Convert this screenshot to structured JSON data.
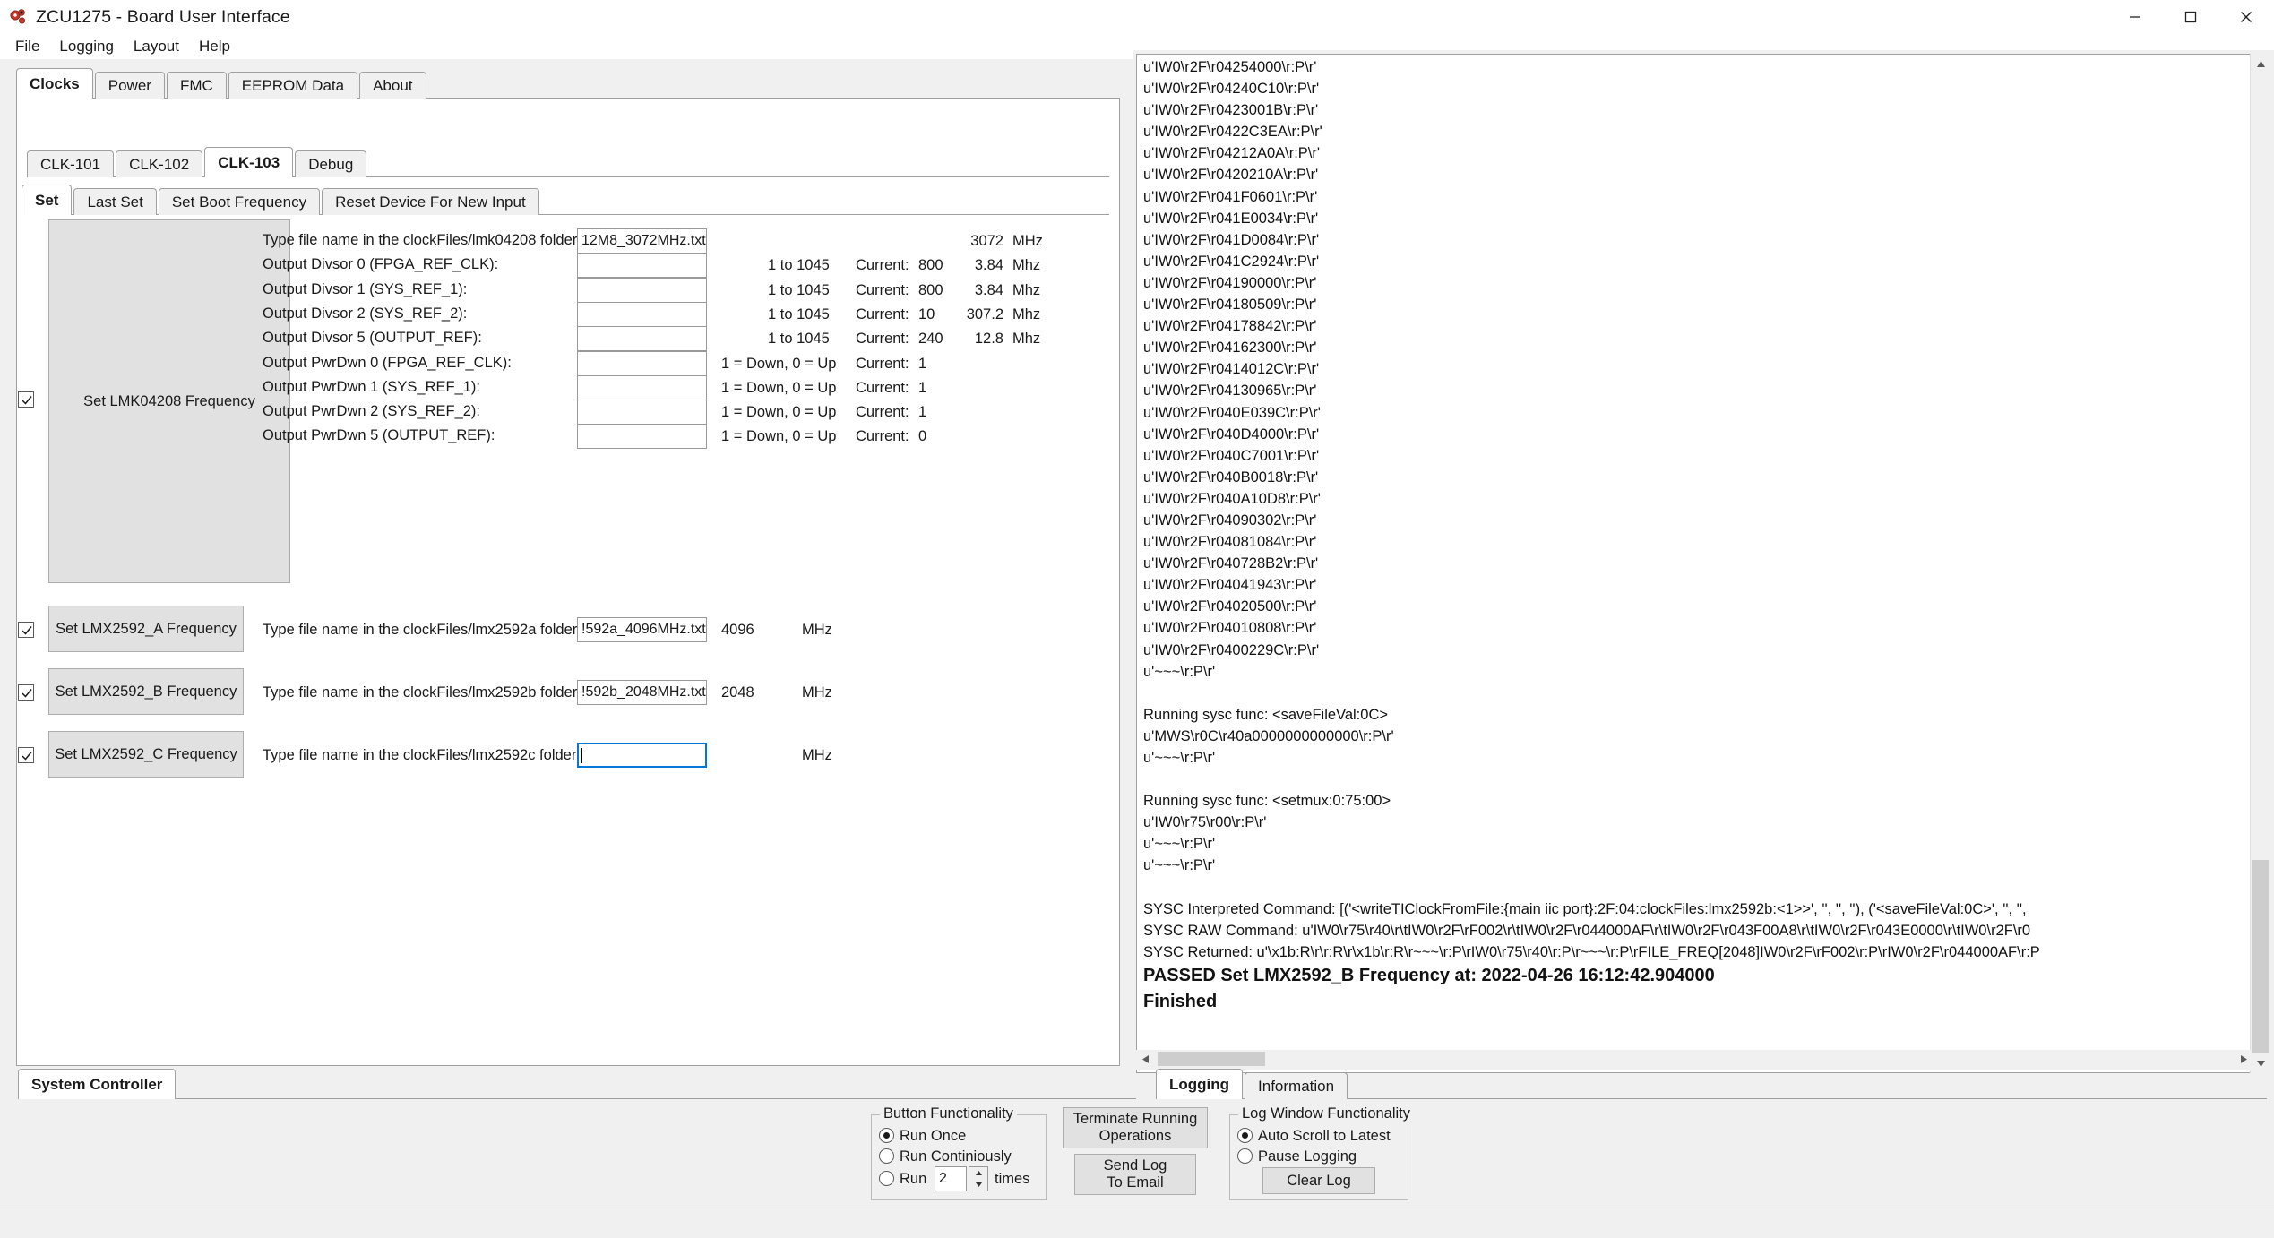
{
  "window": {
    "title": "ZCU1275 - Board User Interface",
    "icon": "gears-icon",
    "buttons": {
      "minimize": "minimize-icon",
      "maximize": "maximize-icon",
      "close": "close-icon"
    }
  },
  "menu": {
    "items": [
      "File",
      "Logging",
      "Layout",
      "Help"
    ]
  },
  "tabs": {
    "level1": {
      "items": [
        "Clocks",
        "Power",
        "FMC",
        "EEPROM Data",
        "About"
      ],
      "active": "Clocks"
    },
    "level2": {
      "items": [
        "CLK-101",
        "CLK-102",
        "CLK-103",
        "Debug"
      ],
      "active": "CLK-103"
    },
    "level3": {
      "items": [
        "Set",
        "Last Set",
        "Set Boot Frequency",
        "Reset Device For New Input"
      ],
      "active": "Set"
    }
  },
  "lmk": {
    "checkbox_checked": true,
    "button_label": "Set LMK04208 Frequency",
    "rows": [
      {
        "label": "Type file name in the clockFiles/lmk04208 folder:",
        "value": "12M8_3072MHz.txt",
        "range": "",
        "current_label": "",
        "current": "",
        "freq": "3072",
        "unit": "MHz"
      },
      {
        "label": "Output Divsor 0 (FPGA_REF_CLK):",
        "value": "",
        "range": "1 to 1045",
        "current_label": "Current:",
        "current": "800",
        "freq": "3.84",
        "unit": "Mhz"
      },
      {
        "label": "Output Divsor 1 (SYS_REF_1):",
        "value": "",
        "range": "1 to 1045",
        "current_label": "Current:",
        "current": "800",
        "freq": "3.84",
        "unit": "Mhz"
      },
      {
        "label": "Output Divsor 2 (SYS_REF_2):",
        "value": "",
        "range": "1 to 1045",
        "current_label": "Current:",
        "current": "10",
        "freq": "307.2",
        "unit": "Mhz"
      },
      {
        "label": "Output Divsor 5 (OUTPUT_REF):",
        "value": "",
        "range": "1 to 1045",
        "current_label": "Current:",
        "current": "240",
        "freq": "12.8",
        "unit": "Mhz"
      },
      {
        "label": "Output PwrDwn 0 (FPGA_REF_CLK):",
        "value": "",
        "range": "1 = Down, 0 = Up",
        "current_label": "Current:",
        "current": "1",
        "freq": "",
        "unit": ""
      },
      {
        "label": "Output PwrDwn 1 (SYS_REF_1):",
        "value": "",
        "range": "1 = Down, 0 = Up",
        "current_label": "Current:",
        "current": "1",
        "freq": "",
        "unit": ""
      },
      {
        "label": "Output PwrDwn 2 (SYS_REF_2):",
        "value": "",
        "range": "1 = Down, 0 = Up",
        "current_label": "Current:",
        "current": "1",
        "freq": "",
        "unit": ""
      },
      {
        "label": "Output PwrDwn 5 (OUTPUT_REF):",
        "value": "",
        "range": "1 = Down, 0 = Up",
        "current_label": "Current:",
        "current": "0",
        "freq": "",
        "unit": ""
      }
    ]
  },
  "lmx": [
    {
      "checked": true,
      "button_label": "Set LMX2592_A Frequency",
      "label": "Type file name in the clockFiles/lmx2592a folder:",
      "value": "!592a_4096MHz.txt",
      "freq": "4096",
      "unit": "MHz",
      "focused": false
    },
    {
      "checked": true,
      "button_label": "Set LMX2592_B Frequency",
      "label": "Type file name in the clockFiles/lmx2592b folder:",
      "value": "!592b_2048MHz.txt",
      "freq": "2048",
      "unit": "MHz",
      "focused": false
    },
    {
      "checked": true,
      "button_label": "Set LMX2592_C Frequency",
      "label": "Type file name in the clockFiles/lmx2592c folder:",
      "value": "",
      "freq": "",
      "unit": "MHz",
      "focused": true
    }
  ],
  "log": {
    "lines": [
      "u'IW0\\r2F\\r04254000\\r:P\\r'",
      "u'IW0\\r2F\\r04240C10\\r:P\\r'",
      "u'IW0\\r2F\\r0423001B\\r:P\\r'",
      "u'IW0\\r2F\\r0422C3EA\\r:P\\r'",
      "u'IW0\\r2F\\r04212A0A\\r:P\\r'",
      "u'IW0\\r2F\\r0420210A\\r:P\\r'",
      "u'IW0\\r2F\\r041F0601\\r:P\\r'",
      "u'IW0\\r2F\\r041E0034\\r:P\\r'",
      "u'IW0\\r2F\\r041D0084\\r:P\\r'",
      "u'IW0\\r2F\\r041C2924\\r:P\\r'",
      "u'IW0\\r2F\\r04190000\\r:P\\r'",
      "u'IW0\\r2F\\r04180509\\r:P\\r'",
      "u'IW0\\r2F\\r04178842\\r:P\\r'",
      "u'IW0\\r2F\\r04162300\\r:P\\r'",
      "u'IW0\\r2F\\r0414012C\\r:P\\r'",
      "u'IW0\\r2F\\r04130965\\r:P\\r'",
      "u'IW0\\r2F\\r040E039C\\r:P\\r'",
      "u'IW0\\r2F\\r040D4000\\r:P\\r'",
      "u'IW0\\r2F\\r040C7001\\r:P\\r'",
      "u'IW0\\r2F\\r040B0018\\r:P\\r'",
      "u'IW0\\r2F\\r040A10D8\\r:P\\r'",
      "u'IW0\\r2F\\r04090302\\r:P\\r'",
      "u'IW0\\r2F\\r04081084\\r:P\\r'",
      "u'IW0\\r2F\\r040728B2\\r:P\\r'",
      "u'IW0\\r2F\\r04041943\\r:P\\r'",
      "u'IW0\\r2F\\r04020500\\r:P\\r'",
      "u'IW0\\r2F\\r04010808\\r:P\\r'",
      "u'IW0\\r2F\\r0400229C\\r:P\\r'",
      "u'~~~\\r:P\\r'",
      "",
      "Running sysc func: <saveFileVal:0C>",
      "u'MWS\\r0C\\r40a0000000000000\\r:P\\r'",
      "u'~~~\\r:P\\r'",
      "",
      "Running sysc func: <setmux:0:75:00>",
      "u'IW0\\r75\\r00\\r:P\\r'",
      "u'~~~\\r:P\\r'",
      "u'~~~\\r:P\\r'",
      "",
      "SYSC Interpreted Command: [('<writeTIClockFromFile:{main iic port}:2F:04:clockFiles:lmx2592b:<1>>', '', '', ''), ('<saveFileVal:0C>', '', '',",
      "SYSC RAW Command: u'IW0\\r75\\r40\\r\\tIW0\\r2F\\rF002\\r\\tIW0\\r2F\\r044000AF\\r\\tIW0\\r2F\\r043F00A8\\r\\tIW0\\r2F\\r043E0000\\r\\tIW0\\r2F\\r0",
      "SYSC Returned: u'\\x1b:R\\r\\r:R\\r\\x1b\\r:R\\r~~~\\r:P\\rIW0\\r75\\r40\\r:P\\r~~~\\r:P\\rFILE_FREQ[2048]IW0\\r2F\\rF002\\r:P\\rIW0\\r2F\\r044000AF\\r:P"
    ],
    "result_lines": [
      "PASSED Set LMX2592_B Frequency at: 2022-04-26 16:12:42.904000",
      "Finished"
    ]
  },
  "bottom": {
    "system_controller_tab": "System Controller",
    "log_tabs": {
      "items": [
        "Logging",
        "Information"
      ],
      "active": "Logging"
    },
    "button_functionality": {
      "title": "Button Functionality",
      "options": [
        "Run Once",
        "Run Continiously",
        "Run"
      ],
      "selected": "Run Once",
      "times_value": "2",
      "times_label": "times"
    },
    "actions": {
      "terminate_label": "Terminate Running\nOperations",
      "terminate_line1": "Terminate Running",
      "terminate_line2": "Operations",
      "send_log_line1": "Send Log",
      "send_log_line2": "To Email"
    },
    "log_window_functionality": {
      "title": "Log Window Functionality",
      "options": [
        "Auto Scroll to Latest",
        "Pause Logging"
      ],
      "selected": "Auto Scroll to Latest",
      "clear_label": "Clear Log"
    }
  }
}
